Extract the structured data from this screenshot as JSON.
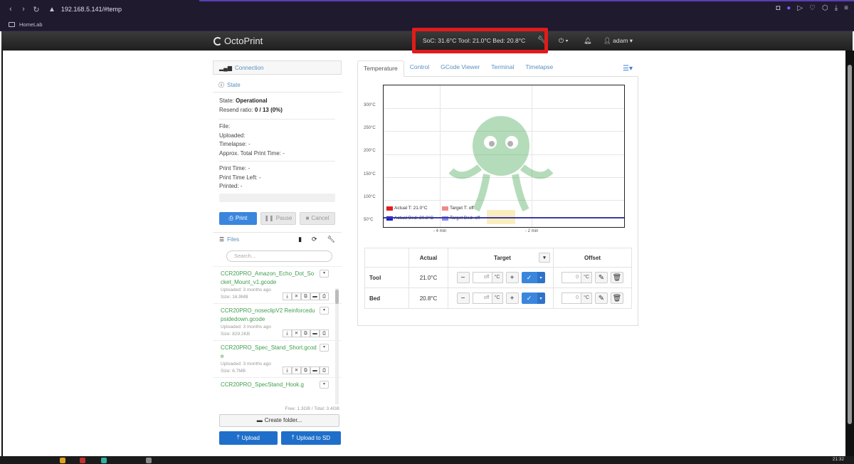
{
  "browser": {
    "url": "192.168.5.141/#temp",
    "bookmark": "HomeLab"
  },
  "navbar": {
    "brand": "OctoPrint",
    "temperature_status": "SoC: 31.6°C Tool: 21.0°C Bed: 20.8°C",
    "user": "adam"
  },
  "sidebar": {
    "connection_label": "Connection",
    "state_label": "State",
    "state_line": {
      "label": "State:",
      "value": "Operational"
    },
    "resend_line": {
      "label": "Resend ratio:",
      "value": "0 / 13 (0%)"
    },
    "file_lines": [
      "File:",
      "Uploaded:",
      "Timelapse: -",
      "Approx. Total Print Time: -"
    ],
    "time_lines": [
      "Print Time: -",
      "Print Time Left: -",
      "Printed: -"
    ],
    "print_btn": "Print",
    "pause_btn": "Pause",
    "cancel_btn": "Cancel",
    "files_label": "Files",
    "search_placeholder": "Search...",
    "files": [
      {
        "name": "CCR20PRO_Amazon_Echo_Dot_Socket_Mount_v1.gcode",
        "uploaded": "Uploaded: 3 months ago",
        "size": "Size: 16.9MB"
      },
      {
        "name": "CCR20PRO_noseclipV2 Reinforcedupsidedown.gcode",
        "uploaded": "Uploaded: 3 months ago",
        "size": "Size: 829.2KB"
      },
      {
        "name": "CCR20PRO_Spec_Stand_Short.gcode",
        "uploaded": "Uploaded: 3 months ago",
        "size": "Size: 6.7MB"
      },
      {
        "name": "CCR20PRO_SpecStand_Hook.g",
        "uploaded": "",
        "size": ""
      }
    ],
    "free_total": "Free: 1.3GB / Total: 3.4GB",
    "create_folder": "Create folder...",
    "upload": "Upload",
    "upload_sd": "Upload to SD"
  },
  "main": {
    "tabs": [
      "Temperature",
      "Control",
      "GCode Viewer",
      "Terminal",
      "Timelapse"
    ],
    "chart": {
      "y_ticks": [
        "300°C",
        "250°C",
        "200°C",
        "150°C",
        "100°C",
        "50°C"
      ],
      "x_ticks": [
        "- 4 min",
        "- 2 min"
      ],
      "legend": [
        {
          "label": "Actual T: 21.0°C",
          "color": "#e02020"
        },
        {
          "label": "Target T: off",
          "color": "#f08a8a"
        },
        {
          "label": "Actual Bed: 20.8°C",
          "color": "#2020c0"
        },
        {
          "label": "Target Bed: off",
          "color": "#8a8af0"
        }
      ]
    },
    "table": {
      "headers": [
        "Actual",
        "Target",
        "Offset"
      ],
      "rows": [
        {
          "name": "Tool",
          "actual": "21.0°C",
          "target": "off",
          "unit": "°C",
          "offset": "0",
          "offset_unit": "°C"
        },
        {
          "name": "Bed",
          "actual": "20.8°C",
          "target": "off",
          "unit": "°C",
          "offset": "0",
          "offset_unit": "°C"
        }
      ]
    }
  },
  "taskbar": {
    "clock": "21:32"
  }
}
